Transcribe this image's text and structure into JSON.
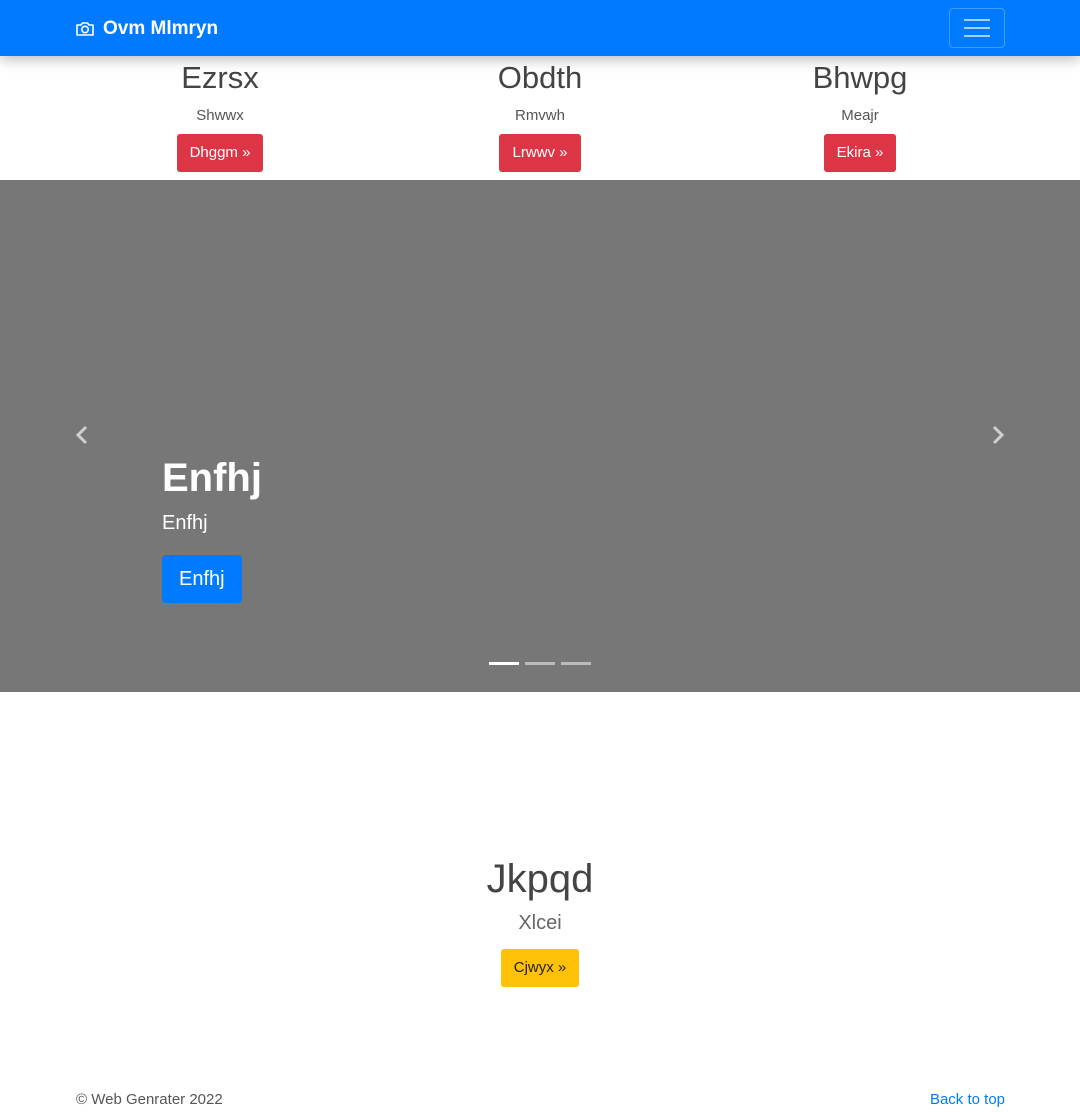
{
  "navbar": {
    "brand": "Ovm Mlmryn",
    "brand_icon": "camera-icon",
    "toggler_icon": "hamburger-menu-icon",
    "color": "#007bff"
  },
  "features": [
    {
      "title": "Ezrsx",
      "text": "Shwwx",
      "button": "Dhggm »"
    },
    {
      "title": "Obdth",
      "text": "Rmvwh",
      "button": "Lrwwv »"
    },
    {
      "title": "Bhwpg",
      "text": "Meajr",
      "button": "Ekira »"
    }
  ],
  "carousel": {
    "heading": "Enfhj",
    "text": "Enfhj",
    "button": "Enfhj",
    "prev_icon": "chevron-left-icon",
    "next_icon": "chevron-right-icon",
    "background": "#777777",
    "slide_count": 3,
    "active_index": 0
  },
  "hero": {
    "title": "Jkpqd",
    "text": "Xlcei",
    "button": "Cjwyx »"
  },
  "footer": {
    "copyright": "© Web Genrater 2022",
    "back_to_top": "Back to top"
  },
  "colors": {
    "primary": "#007bff",
    "danger": "#dc3545",
    "warning": "#ffc107"
  }
}
